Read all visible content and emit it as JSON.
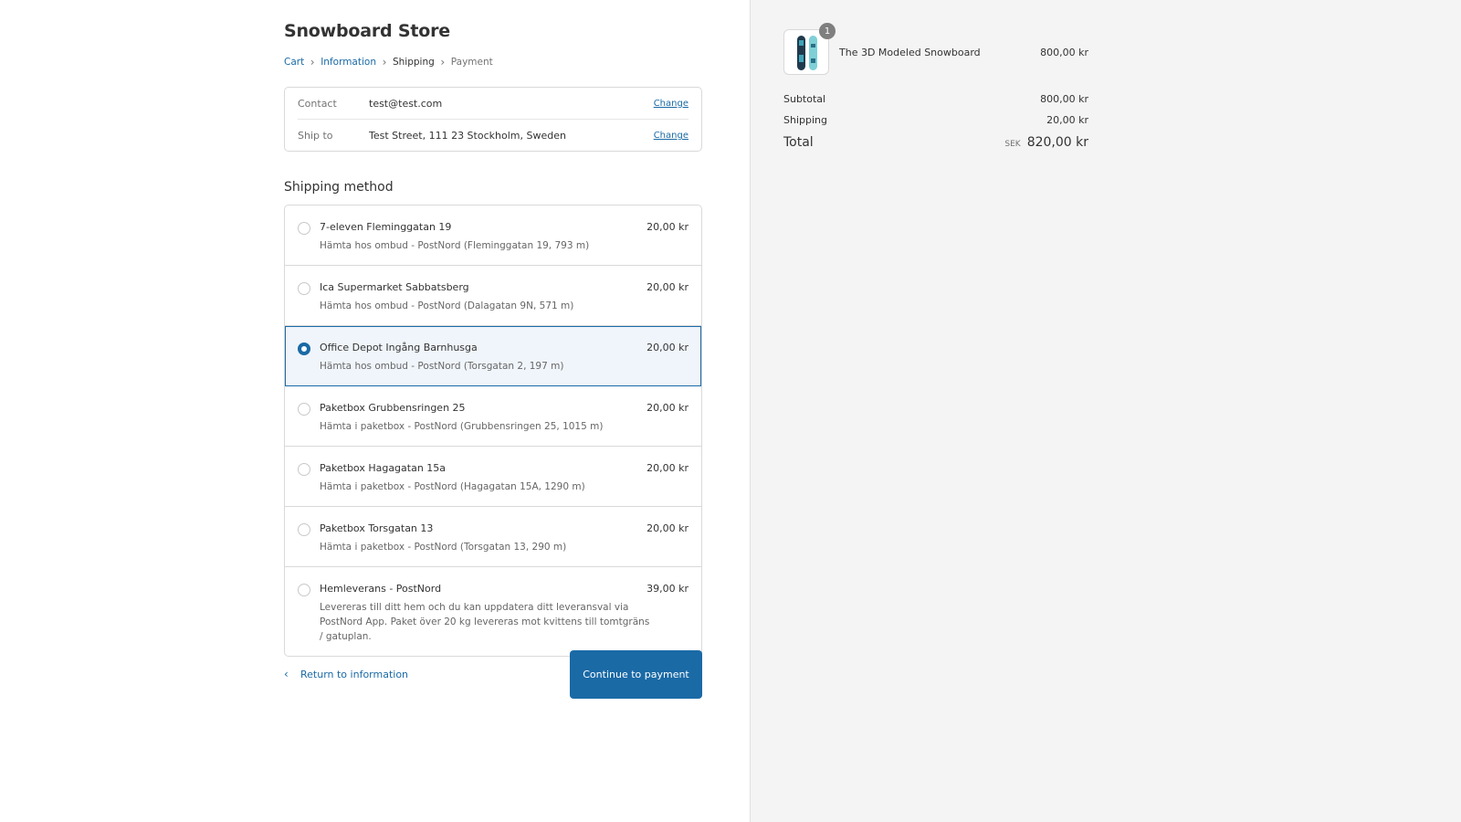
{
  "store": {
    "title": "Snowboard Store"
  },
  "breadcrumb": {
    "cart": "Cart",
    "information": "Information",
    "shipping": "Shipping",
    "payment": "Payment"
  },
  "review": {
    "contact_label": "Contact",
    "contact_value": "test@test.com",
    "ship_label": "Ship to",
    "ship_value": "Test Street, 111 23 Stockholm, Sweden",
    "change_label": "Change"
  },
  "shipping_method": {
    "title": "Shipping method",
    "options": [
      {
        "name": "7-eleven Fleminggatan 19",
        "desc": "Hämta hos ombud - PostNord (Fleminggatan 19, 793 m)",
        "price": "20,00 kr"
      },
      {
        "name": "Ica Supermarket Sabbatsberg",
        "desc": "Hämta hos ombud - PostNord (Dalagatan 9N, 571 m)",
        "price": "20,00 kr"
      },
      {
        "name": "Office Depot Ingång Barnhusga",
        "desc": "Hämta hos ombud - PostNord (Torsgatan 2, 197 m)",
        "price": "20,00 kr"
      },
      {
        "name": "Paketbox Grubbensringen 25",
        "desc": "Hämta i paketbox - PostNord (Grubbensringen 25, 1015 m)",
        "price": "20,00 kr"
      },
      {
        "name": "Paketbox Hagagatan 15a",
        "desc": "Hämta i paketbox - PostNord (Hagagatan 15A, 1290 m)",
        "price": "20,00 kr"
      },
      {
        "name": "Paketbox Torsgatan 13",
        "desc": "Hämta i paketbox - PostNord (Torsgatan 13, 290 m)",
        "price": "20,00 kr"
      },
      {
        "name": "Hemleverans - PostNord",
        "desc": "Levereras till ditt hem och du kan uppdatera ditt leveransval via PostNord App. Paket över 20 kg levereras mot kvittens till tomtgräns / gatuplan.",
        "price": "39,00 kr"
      }
    ]
  },
  "actions": {
    "return_label": "Return to information",
    "continue_label": "Continue to payment"
  },
  "summary": {
    "product_name": "The 3D Modeled Snowboard",
    "product_price": "800,00 kr",
    "product_qty": "1",
    "subtotal_label": "Subtotal",
    "subtotal_value": "800,00 kr",
    "shipping_label": "Shipping",
    "shipping_value": "20,00 kr",
    "total_label": "Total",
    "currency": "SEK",
    "total_value": "820,00 kr"
  },
  "colors": {
    "accent": "#1a6aa6",
    "panel": "#f4f4f4",
    "selected_bg": "#f0f5fb"
  }
}
